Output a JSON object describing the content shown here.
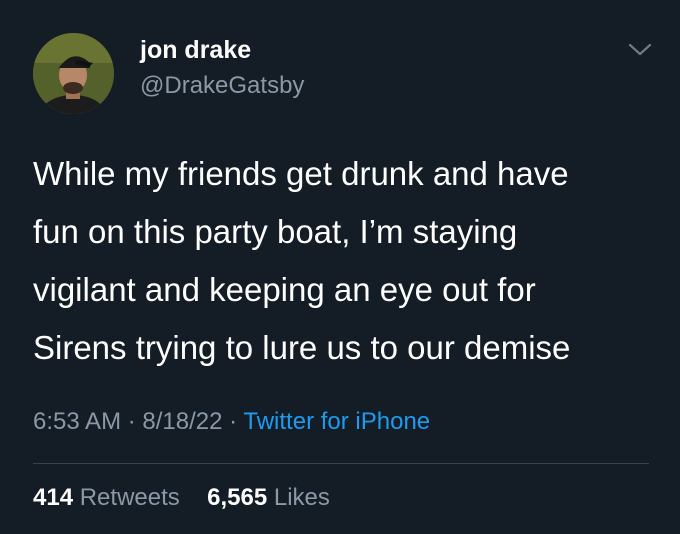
{
  "author": {
    "display_name": "jon drake",
    "handle": "@DrakeGatsby"
  },
  "tweet": {
    "text_lines": [
      "While my friends get drunk and have",
      "fun on this party boat, I’m staying",
      "vigilant and keeping an eye out for",
      "Sirens trying to lure us to our demise"
    ],
    "time": "6:53 AM",
    "separator": "·",
    "date": "8/18/22",
    "source": "Twitter for iPhone"
  },
  "stats": {
    "retweets_count": "414",
    "retweets_label": "Retweets",
    "likes_count": "6,565",
    "likes_label": "Likes"
  },
  "icons": {
    "menu": "chevron-down-icon",
    "avatar": "avatar"
  },
  "colors": {
    "background": "#141c26",
    "secondary_text": "#8b98a5",
    "link": "#1d9bf0",
    "divider": "#38444d"
  }
}
